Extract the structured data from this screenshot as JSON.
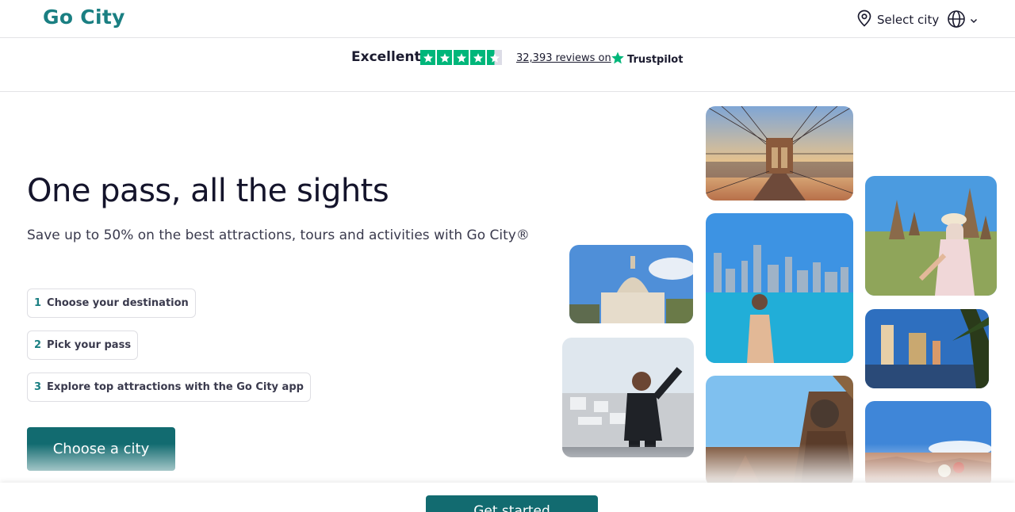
{
  "header": {
    "logo": "Go City",
    "select_city": "Select city",
    "icons": {
      "location": "location-pin-icon",
      "globe": "globe-icon",
      "chevron": "chevron-down-icon"
    }
  },
  "trustpilot": {
    "rating_word": "Excellent",
    "stars": 4.5,
    "reviews": "32,393 reviews on",
    "brand": "Trustpilot",
    "star_color": "#00b67a"
  },
  "hero": {
    "title": "One pass, all the sights",
    "subtitle": "Save up to 50% on the best attractions, tours and activities with Go City®",
    "steps": [
      {
        "num": "1",
        "label": "Choose your destination"
      },
      {
        "num": "2",
        "label": "Pick your pass"
      },
      {
        "num": "3",
        "label": "Explore top attractions with the Go City app"
      }
    ],
    "cta": "Choose a city"
  },
  "sticky": {
    "cta": "Get started"
  },
  "colors": {
    "brand": "#126b70",
    "logo": "#1a7f82"
  },
  "photos": [
    "Brooklyn Bridge",
    "Temples in Thailand",
    "St Paul's Cathedral",
    "Chicago skyline",
    "Las Vegas Strip",
    "Traveller selfie",
    "Temple statue",
    "Grand Canyon"
  ]
}
